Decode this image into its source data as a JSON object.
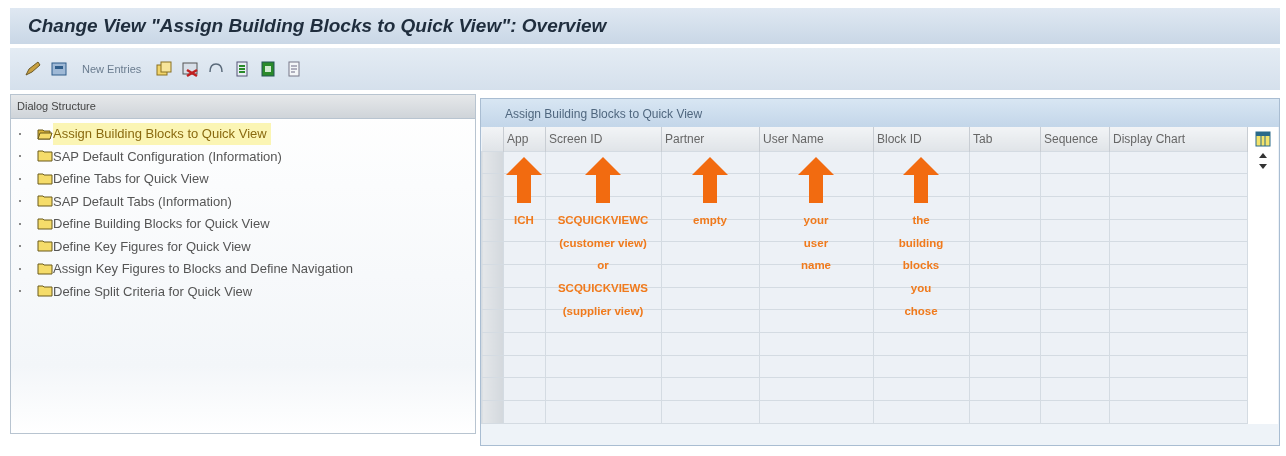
{
  "window": {
    "title": "Change View \"Assign Building Blocks to Quick View\": Overview"
  },
  "toolbar": {
    "new_entries": "New Entries"
  },
  "dialog_structure": {
    "title": "Dialog Structure",
    "items": [
      {
        "label": "Assign Building Blocks to Quick View",
        "selected": true
      },
      {
        "label": "SAP Default Configuration (Information)",
        "selected": false
      },
      {
        "label": "Define Tabs for Quick View",
        "selected": false
      },
      {
        "label": "SAP Default Tabs (Information)",
        "selected": false
      },
      {
        "label": "Define Building Blocks for Quick View",
        "selected": false
      },
      {
        "label": "Define Key Figures for Quick View",
        "selected": false
      },
      {
        "label": "Assign Key Figures to Blocks and Define Navigation",
        "selected": false
      },
      {
        "label": "Define Split Criteria for Quick View",
        "selected": false
      }
    ]
  },
  "table": {
    "title": "Assign Building Blocks to Quick View",
    "columns": [
      {
        "label": "App",
        "annotation": "ICH"
      },
      {
        "label": "Screen ID",
        "annotation": "SCQUICKVIEWC\n(customer view)\nor\nSCQUICKVIEWS\n(supplier view)"
      },
      {
        "label": "Partner",
        "annotation": "empty"
      },
      {
        "label": "User Name",
        "annotation": "your\nuser\nname"
      },
      {
        "label": "Block ID",
        "annotation": "the\nbuilding\nblocks\nyou\nchose"
      },
      {
        "label": "Tab"
      },
      {
        "label": "Sequence"
      },
      {
        "label": "Display Chart"
      }
    ]
  }
}
